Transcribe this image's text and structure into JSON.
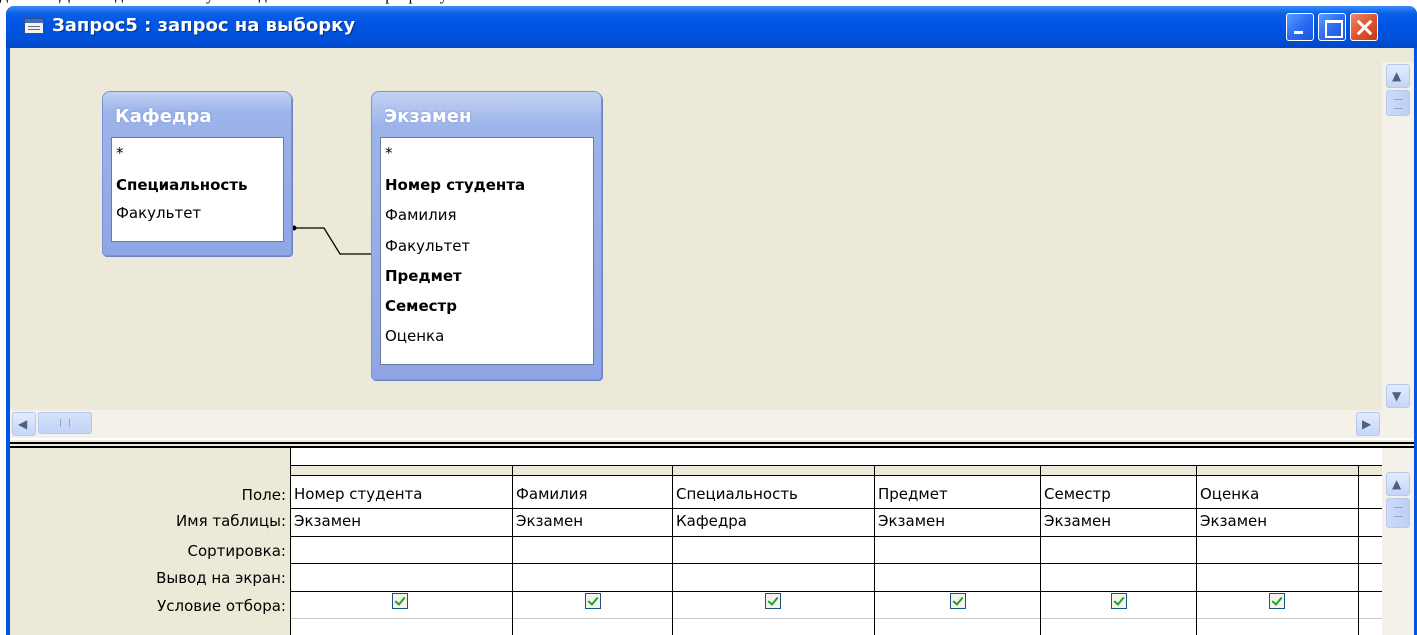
{
  "window": {
    "title": "Запрос5 : запрос на выборку",
    "buttons": {
      "minimize": "_",
      "maximize": "□",
      "close": "X"
    }
  },
  "colors": {
    "titlebar": "#0054e3",
    "table_header": "#8ea6e4",
    "client_bg": "#ece9d8",
    "checkbox_mark": "#21a121"
  },
  "tables": [
    {
      "name": "Кафедра",
      "fields": [
        {
          "label": "*",
          "key": false
        },
        {
          "label": "Специальность",
          "key": true
        },
        {
          "label": "Факультет",
          "key": false
        }
      ]
    },
    {
      "name": "Экзамен",
      "fields": [
        {
          "label": "*",
          "key": false
        },
        {
          "label": "Номер студента",
          "key": true
        },
        {
          "label": "Фамилия",
          "key": false
        },
        {
          "label": "Факультет",
          "key": false
        },
        {
          "label": "Предмет",
          "key": true
        },
        {
          "label": "Семестр",
          "key": true
        },
        {
          "label": "Оценка",
          "key": false
        }
      ]
    }
  ],
  "relationship": {
    "from": "Кафедра.Факультет",
    "to": "Экзамен.Факультет"
  },
  "grid": {
    "row_labels": [
      "Поле:",
      "Имя таблицы:",
      "Сортировка:",
      "Вывод на экран:",
      "Условие отбора:"
    ],
    "columns": [
      {
        "field": "Номер студента",
        "table": "Экзамен",
        "sort": "",
        "show": true
      },
      {
        "field": "Фамилия",
        "table": "Экзамен",
        "sort": "",
        "show": true
      },
      {
        "field": "Специальность",
        "table": "Кафедра",
        "sort": "",
        "show": true
      },
      {
        "field": "Предмет",
        "table": "Экзамен",
        "sort": "",
        "show": true
      },
      {
        "field": "Семестр",
        "table": "Экзамен",
        "sort": "",
        "show": true
      },
      {
        "field": "Оценка",
        "table": "Экзамен",
        "sort": "",
        "show": true
      }
    ]
  },
  "icons": {
    "title": "query-window-icon",
    "scroll_up": "arrow-up-icon",
    "scroll_down": "arrow-down-icon",
    "scroll_left": "arrow-left-icon",
    "scroll_right": "arrow-right-icon",
    "check": "checkbox-checked-icon"
  }
}
